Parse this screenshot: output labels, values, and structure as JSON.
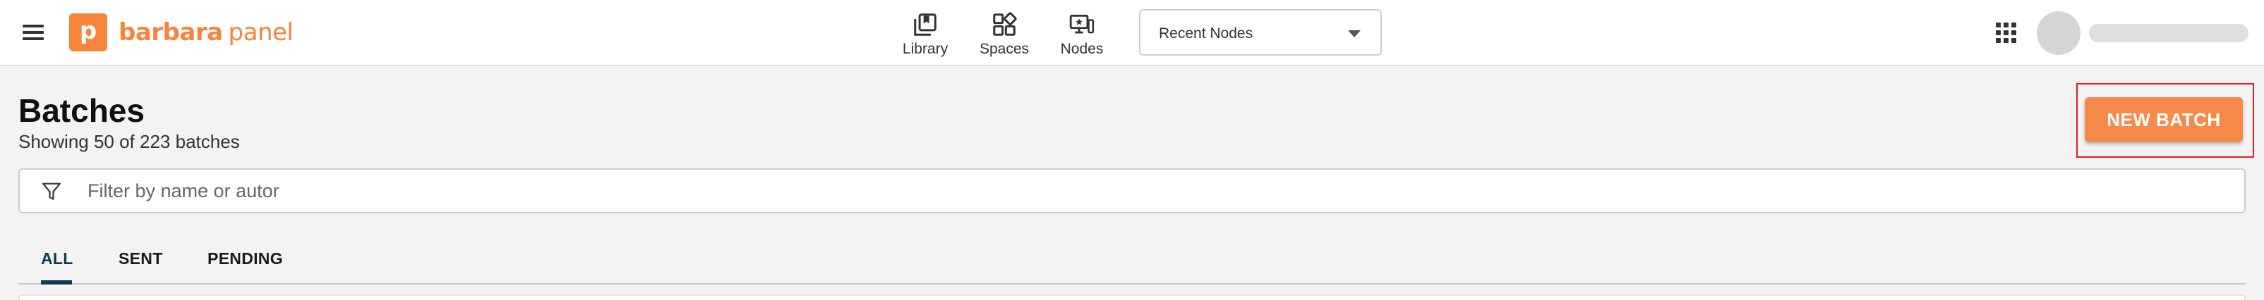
{
  "header": {
    "logo": {
      "mark": "p",
      "name_bold": "barbara",
      "name_thin": "panel"
    },
    "nav": [
      {
        "label": "Library",
        "icon": "library-icon"
      },
      {
        "label": "Spaces",
        "icon": "spaces-icon"
      },
      {
        "label": "Nodes",
        "icon": "nodes-icon"
      }
    ],
    "recent_select": {
      "value": "Recent Nodes"
    }
  },
  "page": {
    "title": "Batches",
    "subtitle": "Showing 50 of 223 batches",
    "new_batch_label": "NEW BATCH"
  },
  "filter": {
    "placeholder": "Filter by name or autor",
    "value": ""
  },
  "tabs": [
    {
      "label": "ALL",
      "active": true
    },
    {
      "label": "SENT",
      "active": false
    },
    {
      "label": "PENDING",
      "active": false
    }
  ],
  "colors": {
    "brand": "#f6843c",
    "primary_button": "#f68a4b",
    "tab_active": "#0f3a4b",
    "highlight_box": "#e11d24",
    "background": "#f3f3f3"
  }
}
